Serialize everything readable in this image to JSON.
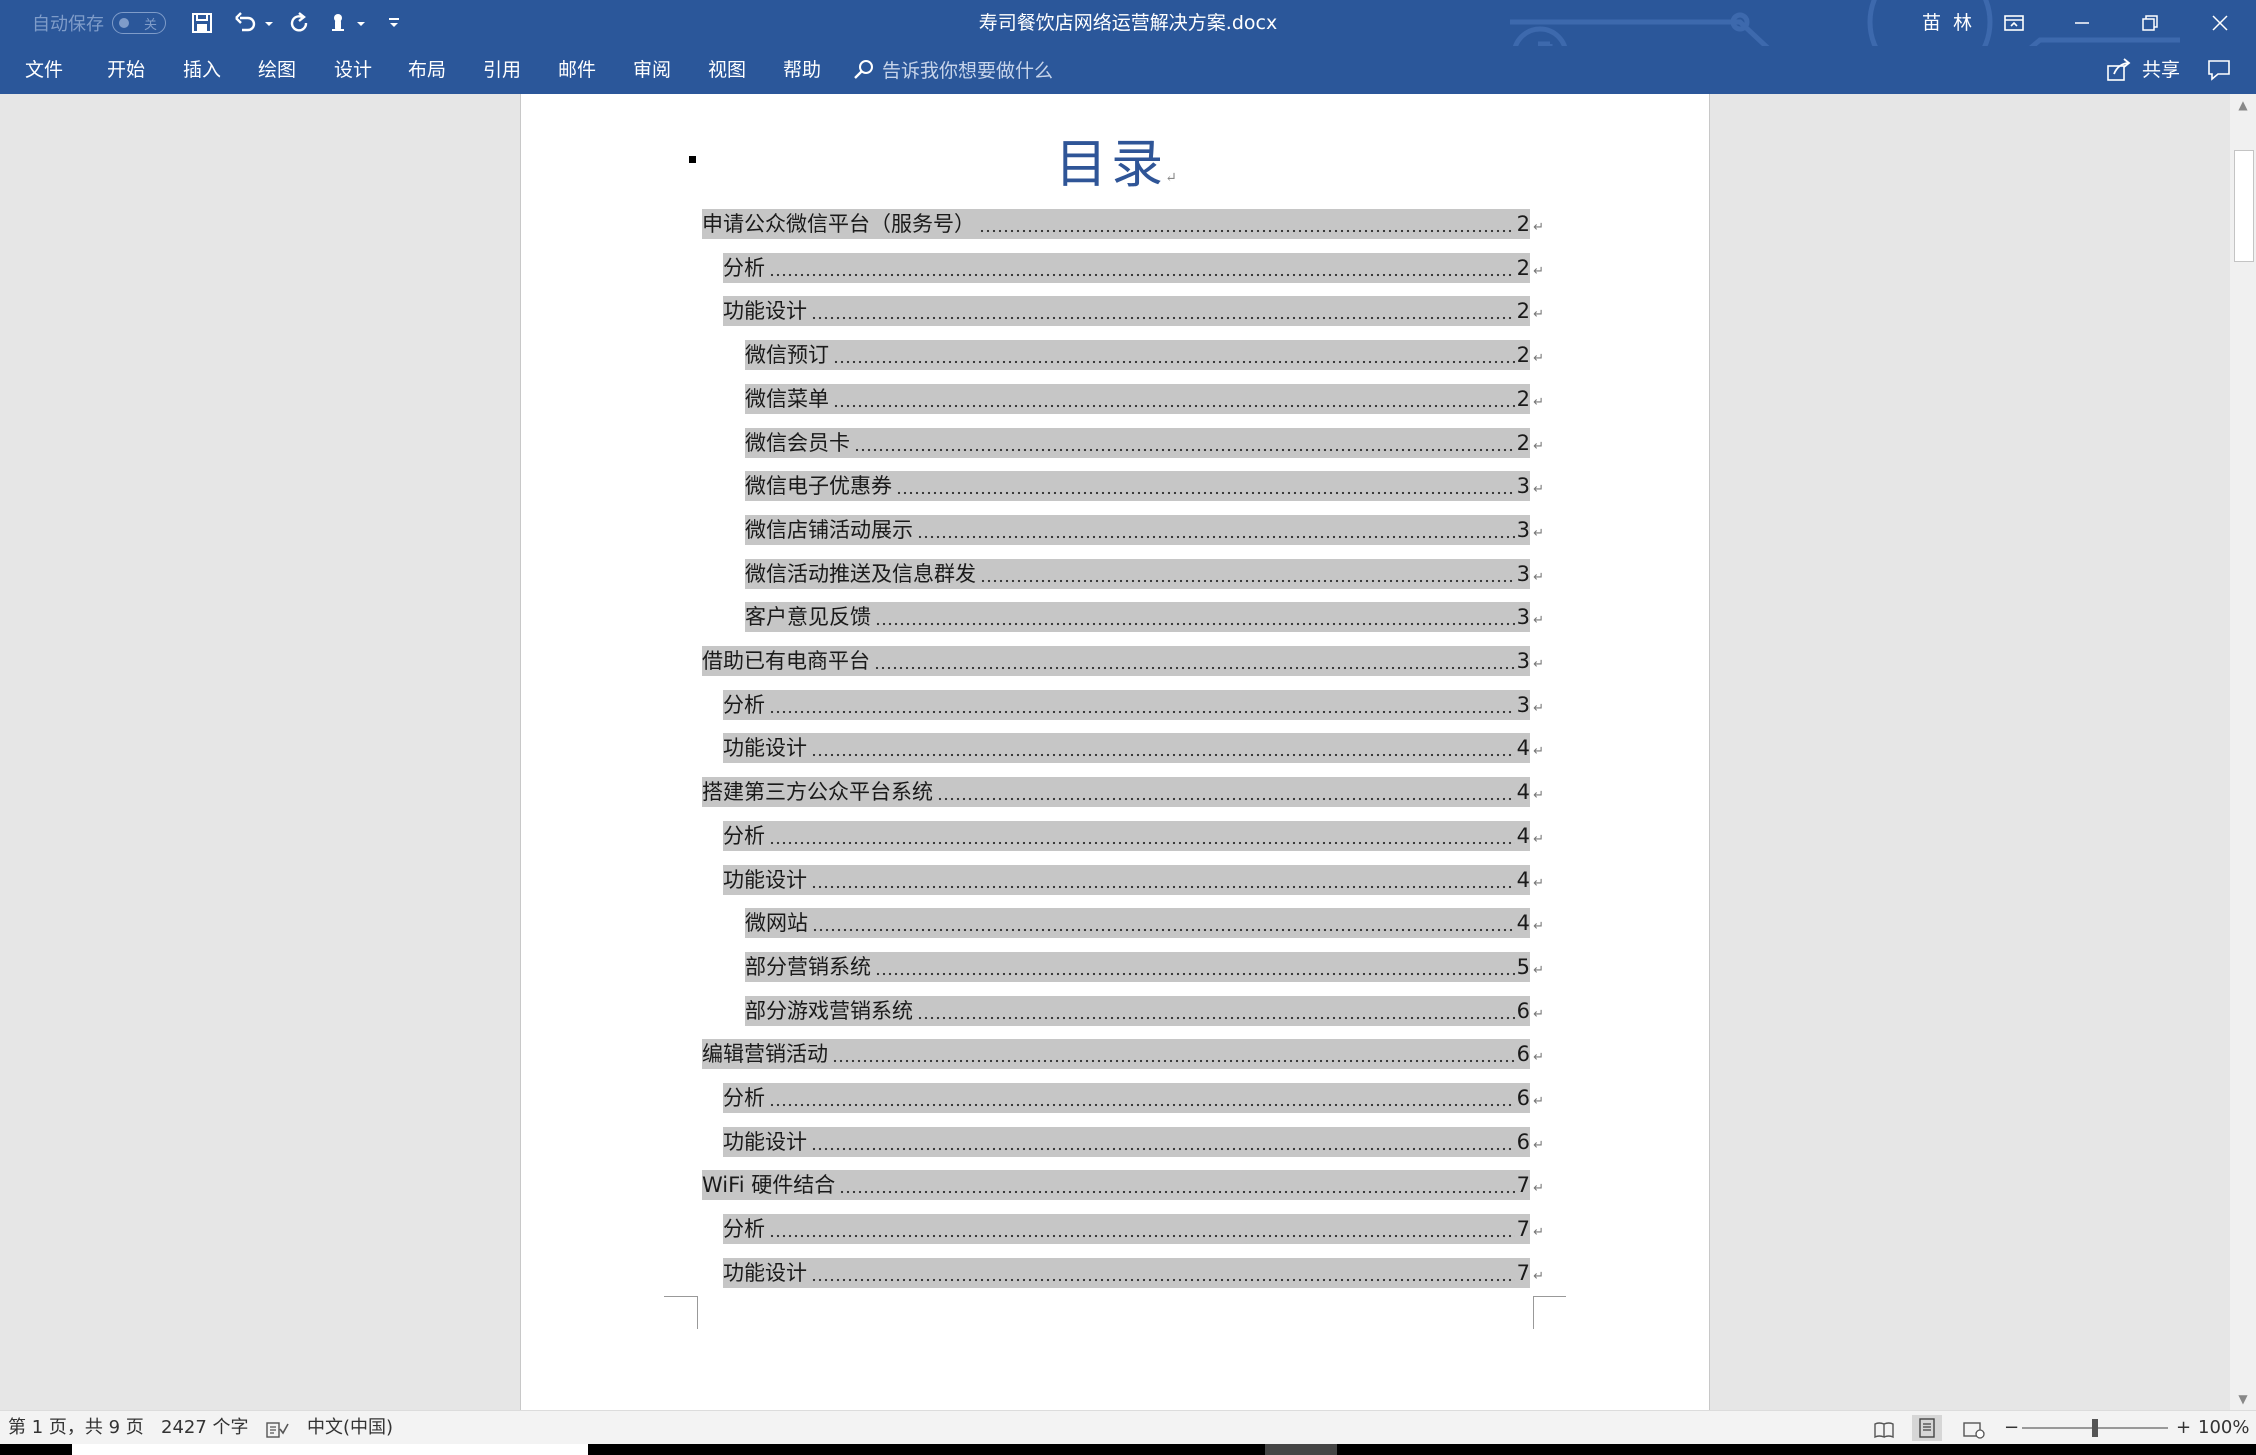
{
  "window": {
    "title": "寿司餐饮店网络运营解决方案.docx",
    "user": "苗 林",
    "accent": "#2b579a"
  },
  "quick_access": {
    "autosave_label": "自动保存",
    "autosave_state": "关",
    "icons": [
      "save-icon",
      "undo-icon",
      "redo-icon",
      "touch-mode-icon",
      "customize-icon"
    ]
  },
  "ribbon": {
    "tabs": [
      "文件",
      "开始",
      "插入",
      "绘图",
      "设计",
      "布局",
      "引用",
      "邮件",
      "审阅",
      "视图",
      "帮助"
    ],
    "tell_me": "告诉我你想要做什么",
    "share": "共享"
  },
  "document": {
    "toc_title": "目录",
    "entries": [
      {
        "level": 1,
        "text": "申请公众微信平台（服务号）",
        "page": "2"
      },
      {
        "level": 2,
        "text": "分析",
        "page": "2"
      },
      {
        "level": 2,
        "text": "功能设计",
        "page": "2"
      },
      {
        "level": 3,
        "text": "微信预订",
        "page": "2"
      },
      {
        "level": 3,
        "text": "微信菜单",
        "page": "2"
      },
      {
        "level": 3,
        "text": "微信会员卡",
        "page": "2"
      },
      {
        "level": 3,
        "text": "微信电子优惠券",
        "page": "3"
      },
      {
        "level": 3,
        "text": "微信店铺活动展示",
        "page": "3"
      },
      {
        "level": 3,
        "text": "微信活动推送及信息群发",
        "page": "3"
      },
      {
        "level": 3,
        "text": "客户意见反馈",
        "page": "3"
      },
      {
        "level": 1,
        "text": "借助已有电商平台",
        "page": "3"
      },
      {
        "level": 2,
        "text": "分析",
        "page": "3"
      },
      {
        "level": 2,
        "text": "功能设计",
        "page": "4"
      },
      {
        "level": 1,
        "text": "搭建第三方公众平台系统",
        "page": "4"
      },
      {
        "level": 2,
        "text": "分析",
        "page": "4"
      },
      {
        "level": 2,
        "text": "功能设计",
        "page": "4"
      },
      {
        "level": 3,
        "text": "微网站",
        "page": "4"
      },
      {
        "level": 3,
        "text": "部分营销系统",
        "page": "5"
      },
      {
        "level": 3,
        "text": "部分游戏营销系统",
        "page": "6"
      },
      {
        "level": 1,
        "text": "编辑营销活动",
        "page": "6"
      },
      {
        "level": 2,
        "text": "分析",
        "page": "6"
      },
      {
        "level": 2,
        "text": "功能设计",
        "page": "6"
      },
      {
        "level": 1,
        "text": "WiFi 硬件结合",
        "page": "7"
      },
      {
        "level": 2,
        "text": "分析",
        "page": "7"
      },
      {
        "level": 2,
        "text": "功能设计",
        "page": "7"
      }
    ]
  },
  "status": {
    "page_info": "第 1 页，共 9 页",
    "word_count": "2427 个字",
    "language": "中文(中国)",
    "zoom": "100%",
    "zoom_level_percent": 100
  }
}
